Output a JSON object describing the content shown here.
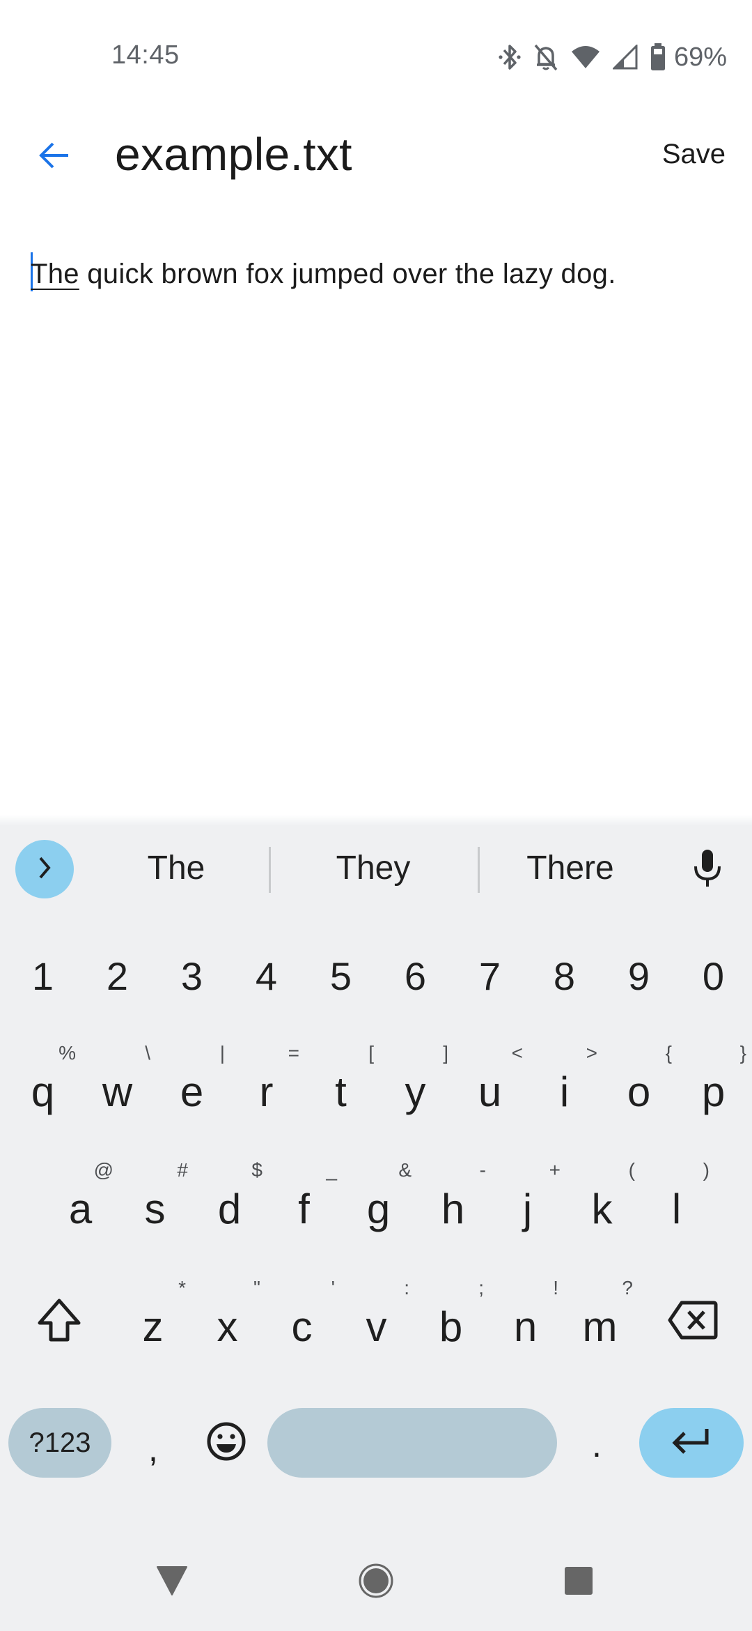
{
  "status_bar": {
    "time": "14:45",
    "battery_percent": "69%",
    "icons": [
      "bluetooth-icon",
      "notifications-off-icon",
      "wifi-icon",
      "cellular-signal-icon",
      "battery-icon"
    ]
  },
  "app_bar": {
    "back_icon": "arrow-back-icon",
    "title": "example.txt",
    "save_label": "Save",
    "accent_color": "#1a73e8"
  },
  "editor": {
    "composing_word": "The",
    "rest_text": " quick brown fox jumped over the lazy dog."
  },
  "keyboard": {
    "suggestions": [
      "The",
      "They",
      "There"
    ],
    "expand_icon": "chevron-right-icon",
    "mic_icon": "microphone-icon",
    "number_row": [
      "1",
      "2",
      "3",
      "4",
      "5",
      "6",
      "7",
      "8",
      "9",
      "0"
    ],
    "row1": [
      {
        "key": "q",
        "hint": "%"
      },
      {
        "key": "w",
        "hint": "\\"
      },
      {
        "key": "e",
        "hint": "|"
      },
      {
        "key": "r",
        "hint": "="
      },
      {
        "key": "t",
        "hint": "["
      },
      {
        "key": "y",
        "hint": "]"
      },
      {
        "key": "u",
        "hint": "<"
      },
      {
        "key": "i",
        "hint": ">"
      },
      {
        "key": "o",
        "hint": "{"
      },
      {
        "key": "p",
        "hint": "}"
      }
    ],
    "row2": [
      {
        "key": "a",
        "hint": "@"
      },
      {
        "key": "s",
        "hint": "#"
      },
      {
        "key": "d",
        "hint": "$"
      },
      {
        "key": "f",
        "hint": "_"
      },
      {
        "key": "g",
        "hint": "&"
      },
      {
        "key": "h",
        "hint": "-"
      },
      {
        "key": "j",
        "hint": "+"
      },
      {
        "key": "k",
        "hint": "("
      },
      {
        "key": "l",
        "hint": ")"
      }
    ],
    "row3": [
      {
        "key": "z",
        "hint": "*"
      },
      {
        "key": "x",
        "hint": "\""
      },
      {
        "key": "c",
        "hint": "'"
      },
      {
        "key": "v",
        "hint": ":"
      },
      {
        "key": "b",
        "hint": ";"
      },
      {
        "key": "n",
        "hint": "!"
      },
      {
        "key": "m",
        "hint": "?"
      }
    ],
    "shift_icon": "shift-icon",
    "backspace_icon": "backspace-icon",
    "symbols_label": "?123",
    "comma": ",",
    "emoji_icon": "emoji-icon",
    "period": ".",
    "enter_icon": "enter-icon",
    "colors": {
      "background": "#eff0f2",
      "accent_key": "#8ccfef",
      "function_key": "#b4cad5"
    }
  },
  "nav_bar": {
    "back": "nav-back-icon",
    "home": "nav-home-icon",
    "recents": "nav-recents-icon"
  }
}
